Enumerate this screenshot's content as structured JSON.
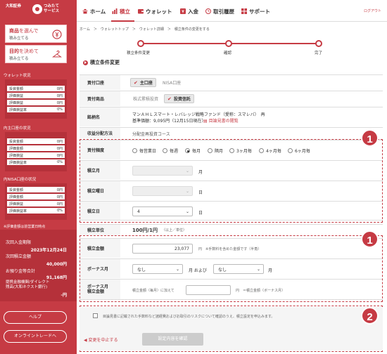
{
  "sidebar": {
    "logo_left": "大和証券",
    "logo_right": "つみたて\nサービス",
    "card1": {
      "highlight": "商品",
      "title_rest": "を選んで",
      "sub": "積み立てる"
    },
    "card2": {
      "highlight": "目的",
      "title_rest": "を決めて",
      "sub": "積み立てる"
    },
    "wallet_head": "ウォレット状況",
    "wallet_rows": [
      {
        "k": "投資金額",
        "v": "0円"
      },
      {
        "k": "評価損益",
        "v": "0円"
      },
      {
        "k": "評価損益",
        "v": "0円"
      },
      {
        "k": "評価損益率",
        "v": "0%"
      }
    ],
    "inner_head": "内主口座の状況",
    "inner_rows": [
      {
        "k": "投資金額",
        "v": "0円"
      },
      {
        "k": "評価金額",
        "v": "0円"
      },
      {
        "k": "評価損益",
        "v": "0円"
      },
      {
        "k": "評価損益率",
        "v": "0%"
      }
    ],
    "nisa_head": "内NISA口座の状況",
    "nisa_rows": [
      {
        "k": "投資金額",
        "v": "0円"
      },
      {
        "k": "評価金額",
        "v": "0円"
      },
      {
        "k": "評価損益",
        "v": "0円"
      },
      {
        "k": "評価損益率",
        "v": "0%"
      }
    ],
    "note": "※評価金額は前営業日時点",
    "next_label": "次回入金期限",
    "next_date": "2023年12月24日",
    "next_amount_label": "次回積立金額",
    "next_amount": "40,000円",
    "shortage_label": "お預り金等合計",
    "shortage": "91,168円",
    "bank_label": "提携金融機関/ダイレクト\n残高(大和ネクスト銀行)",
    "bank_value": "-円",
    "help": "ヘルプ",
    "online": "オンライントレードへ"
  },
  "nav": {
    "home": "ホーム",
    "tsumitate": "積立",
    "wallet": "ウォレット",
    "deposit": "入金",
    "history": "取引履歴",
    "support": "サポート",
    "logout": "ログアウト"
  },
  "breadcrumb": "ホーム　＞　ウォレットトップ　＞　ウォレット詳細　＞　積立条件の変更をする",
  "steps": {
    "s1": "積立条件変更",
    "s2": "確認",
    "s3": "完了"
  },
  "section_title": "積立条件変更",
  "form": {
    "account_label": "買付口座",
    "account_main": "主口座",
    "account_nisa": "NISA口座",
    "product_label": "買付商品",
    "product_stock": "株式累積投資",
    "product_fund": "投資信託",
    "fund_label": "銘柄名",
    "fund_name": "マンＡＨＬスマート・レバレッジ戦略ファンド（愛称：スマレバ）　再",
    "fund_price": "基準価額：9,095円（12月15日現在）",
    "fund_doc": "目論見書の閲覧",
    "dist_label": "収益分配方法",
    "dist_value": "分配金再投資コース",
    "freq_label": "買付頻度",
    "freq_options": [
      "毎営業日",
      "毎週",
      "毎月",
      "隔月",
      "3ヶ月毎",
      "4ヶ月毎",
      "6ヶ月毎"
    ],
    "month_label": "積立月",
    "month_suffix": "月",
    "weekday_label": "積立曜日",
    "weekday_suffix": "日",
    "day_label": "積立日",
    "day_value": "4",
    "day_suffix": "日",
    "unit_label": "積立単位",
    "unit_value": "100円/1円",
    "unit_note": "（以上／単位）",
    "amount_label": "積立金額",
    "amount_value": "23,077",
    "amount_note": "円　※手数料を含めた金額です（半角）",
    "bonus_label": "ボーナス月",
    "bonus1": "なし",
    "bonus_mid": "月 および",
    "bonus2": "なし",
    "bonus_suffix": "月",
    "bonus_amt_label": "ボーナス月\n積立金額",
    "bonus_amt_prefix": "積立金額（毎月）に加えて",
    "bonus_amt_note": "円　＝積立金額（ボーナス月）"
  },
  "agree_text": "目論見書に記載された手数料など諸経費およびお取引のリスクについて確認のうえ、積立設定を申込みます。",
  "back_label": "変更を中止する",
  "confirm_label": "設定内容を確認",
  "badges": {
    "b1": "1",
    "b2": "1",
    "b3": "2"
  }
}
